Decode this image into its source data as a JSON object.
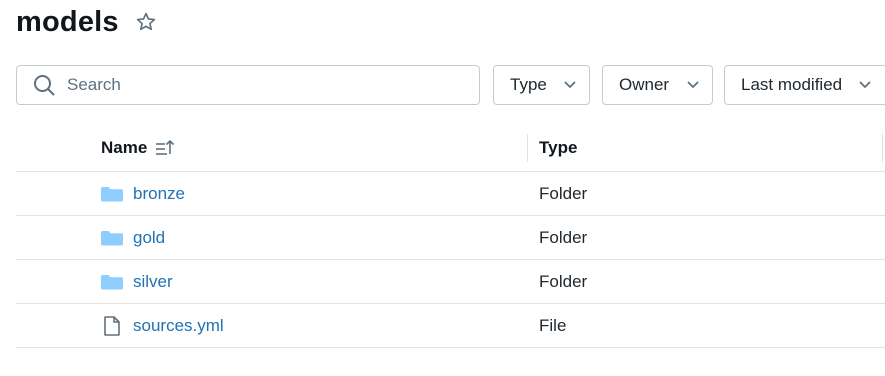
{
  "header": {
    "title": "models"
  },
  "search": {
    "placeholder": "Search"
  },
  "filters": [
    {
      "label": "Type"
    },
    {
      "label": "Owner"
    },
    {
      "label": "Last modified"
    }
  ],
  "table": {
    "columns": [
      "Name",
      "Type"
    ],
    "rows": [
      {
        "name": "bronze",
        "type": "Folder",
        "icon": "folder-icon"
      },
      {
        "name": "gold",
        "type": "Folder",
        "icon": "folder-icon"
      },
      {
        "name": "silver",
        "type": "Folder",
        "icon": "folder-icon"
      },
      {
        "name": "sources.yml",
        "type": "File",
        "icon": "file-icon"
      }
    ]
  },
  "colors": {
    "link": "#2272b4",
    "folder": "#8fcdfe",
    "border": "#c4ccd3",
    "divider": "#dfe3e6",
    "icon": "#5f717f"
  }
}
